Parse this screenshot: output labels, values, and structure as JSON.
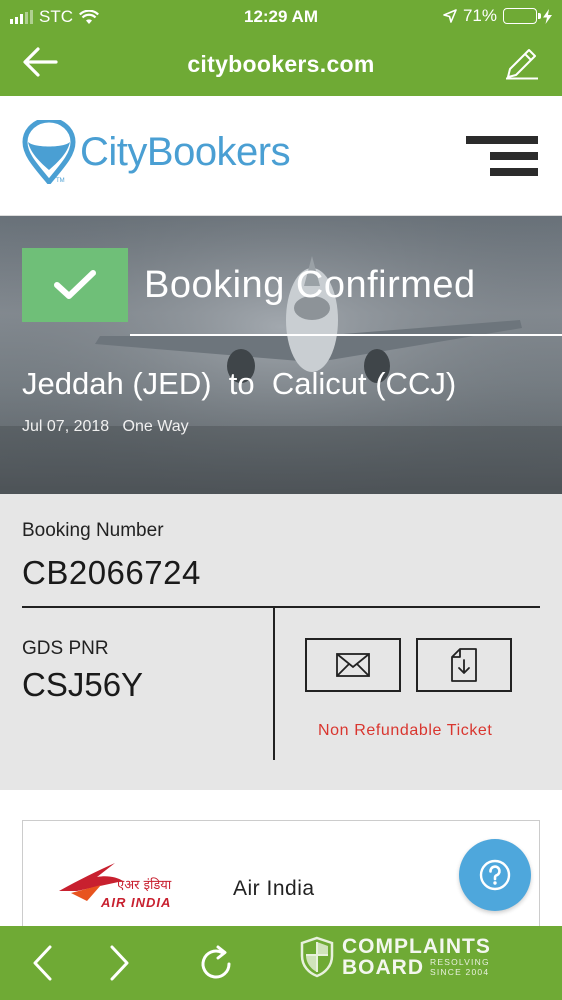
{
  "status_bar": {
    "carrier": "STC",
    "time": "12:29 AM",
    "battery_percent": "71%",
    "battery_level": 0.71
  },
  "browser": {
    "url": "citybookers.com"
  },
  "site": {
    "logo_text": "CityBookers",
    "logo_mark_text": "TM"
  },
  "booking": {
    "status_title": "Booking Confirmed",
    "route_from": "Jeddah (JED)",
    "route_connector": "to",
    "route_to": "Calicut (CCJ)",
    "date": "Jul 07, 2018",
    "trip_type": "One Way",
    "booking_number_label": "Booking Number",
    "booking_number": "CB2066724",
    "pnr_label": "GDS PNR",
    "pnr": "CSJ56Y",
    "refund_note": "Non Refundable Ticket"
  },
  "airline": {
    "name": "Air India",
    "logo_text": "AIR INDIA",
    "logo_text_hindi": "एअर इंडिया"
  },
  "watermark": {
    "line1": "COMPLAINTS",
    "line2": "BOARD",
    "tagline1": "RESOLVING",
    "tagline2": "SINCE 2004"
  },
  "colors": {
    "brand_green": "#6faa35",
    "confirm_green": "#6fbf78",
    "logo_blue": "#4a9fd3",
    "help_blue": "#4ea7dc",
    "refund_red": "#d9362f"
  },
  "icons": [
    "back-arrow-icon",
    "edit-icon",
    "menu-icon",
    "checkmark-icon",
    "mail-icon",
    "download-file-icon",
    "help-icon",
    "chevron-left-icon",
    "chevron-right-icon",
    "reload-icon"
  ]
}
